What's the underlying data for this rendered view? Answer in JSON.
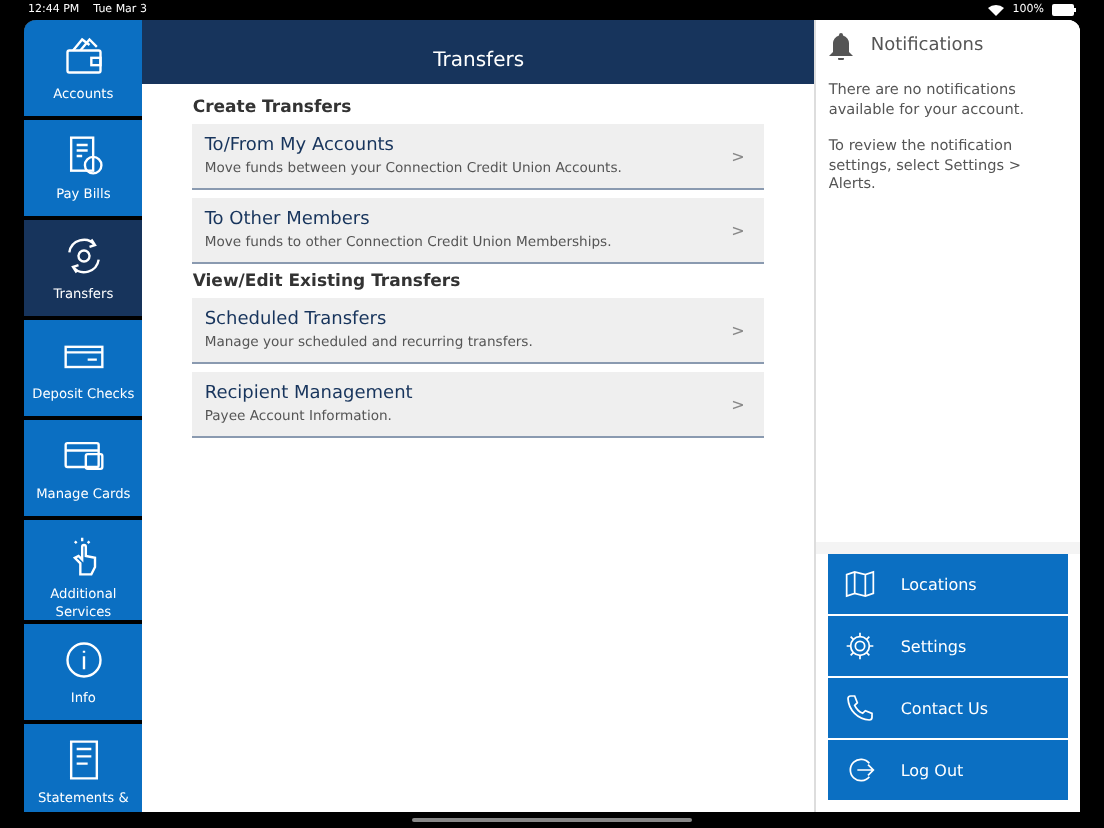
{
  "status_bar": {
    "time": "12:44 PM",
    "date": "Tue Mar 3",
    "battery": "100%"
  },
  "sidebar": {
    "items": [
      {
        "label": "Accounts",
        "selected": false
      },
      {
        "label": "Pay Bills",
        "selected": false
      },
      {
        "label": "Transfers",
        "selected": true
      },
      {
        "label": "Deposit Checks",
        "selected": false
      },
      {
        "label": "Manage Cards",
        "selected": false
      },
      {
        "label": "Additional Services",
        "selected": false
      },
      {
        "label": "Info",
        "selected": false
      },
      {
        "label": "Statements &",
        "selected": false
      }
    ]
  },
  "header": {
    "title": "Transfers"
  },
  "sections": [
    {
      "heading": "Create Transfers",
      "items": [
        {
          "title": "To/From My Accounts",
          "subtitle": "Move funds between your Connection Credit Union Accounts.",
          "chevron": ">"
        },
        {
          "title": "To Other Members",
          "subtitle": "Move funds to other Connection Credit Union Memberships.",
          "chevron": ">"
        }
      ]
    },
    {
      "heading": "View/Edit Existing Transfers",
      "items": [
        {
          "title": "Scheduled Transfers",
          "subtitle": "Manage your scheduled and recurring transfers.",
          "chevron": ">"
        },
        {
          "title": "Recipient Management",
          "subtitle": "Payee Account Information.",
          "chevron": ">"
        }
      ]
    }
  ],
  "notifications": {
    "title": "Notifications",
    "messages": [
      "There are no notifications available for your account.",
      "To review the notification settings, select Settings > Alerts."
    ]
  },
  "actions": [
    "Locations",
    "Settings",
    "Contact Us",
    "Log Out"
  ]
}
